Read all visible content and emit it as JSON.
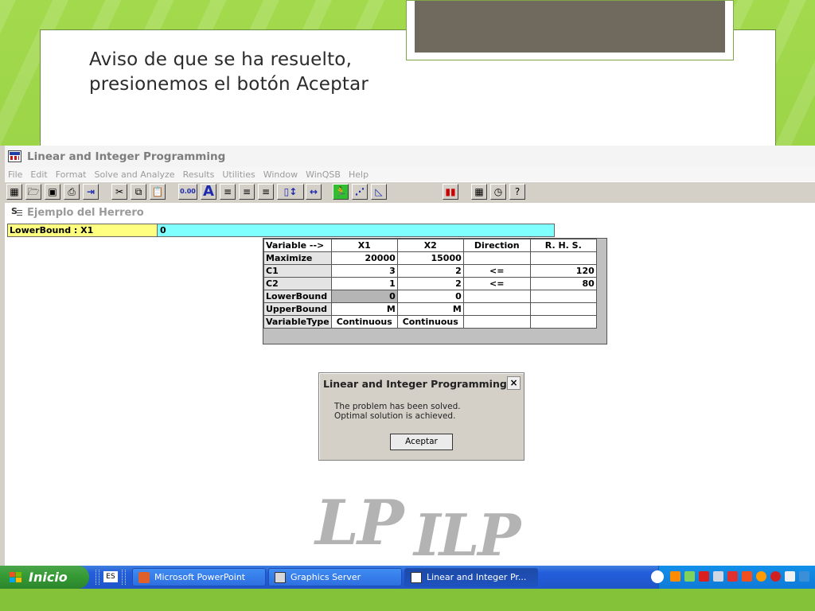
{
  "slide": {
    "line1": "Aviso de que se ha resuelto,",
    "line2": "presionemos el botón Aceptar"
  },
  "app": {
    "title": "Linear and Integer Programming",
    "menu": [
      "File",
      "Edit",
      "Format",
      "Solve and Analyze",
      "Results",
      "Utilities",
      "Window",
      "WinQSB",
      "Help"
    ],
    "document_title": "Ejemplo del Herrero"
  },
  "toolbar": {
    "decimal_label": "0.00",
    "font_label": "A"
  },
  "cellbar": {
    "name": "LowerBound : X1",
    "value": "0"
  },
  "table": {
    "headers": [
      "Variable -->",
      "X1",
      "X2",
      "Direction",
      "R. H. S."
    ],
    "rows": [
      {
        "label": "Maximize",
        "x1": "20000",
        "x2": "15000",
        "direction": "",
        "rhs": ""
      },
      {
        "label": "C1",
        "x1": "3",
        "x2": "2",
        "direction": "<=",
        "rhs": "120"
      },
      {
        "label": "C2",
        "x1": "1",
        "x2": "2",
        "direction": "<=",
        "rhs": "80"
      },
      {
        "label": "LowerBound",
        "x1": "0",
        "x2": "0",
        "direction": "",
        "rhs": ""
      },
      {
        "label": "UpperBound",
        "x1": "M",
        "x2": "M",
        "direction": "",
        "rhs": ""
      },
      {
        "label": "VariableType",
        "x1": "Continuous",
        "x2": "Continuous",
        "direction": "",
        "rhs": ""
      }
    ]
  },
  "dialog": {
    "title": "Linear and Integer Programming",
    "close": "×",
    "message_line1": "The problem has been solved.",
    "message_line2": "Optimal solution is achieved.",
    "ok_label": "Aceptar"
  },
  "watermark": {
    "lp": "LP",
    "ilp": "ILP"
  },
  "taskbar": {
    "start": "Inicio",
    "language": "ES",
    "tasks": [
      "Microsoft PowerPoint",
      "Graphics Server",
      "Linear and Integer Pr..."
    ]
  },
  "colors": {
    "cell_name_bg": "#ffff80",
    "cell_value_bg": "#80ffff",
    "slide_green": "#8fcf3c",
    "taskbar_blue": "#245edc",
    "start_green": "#339933"
  }
}
